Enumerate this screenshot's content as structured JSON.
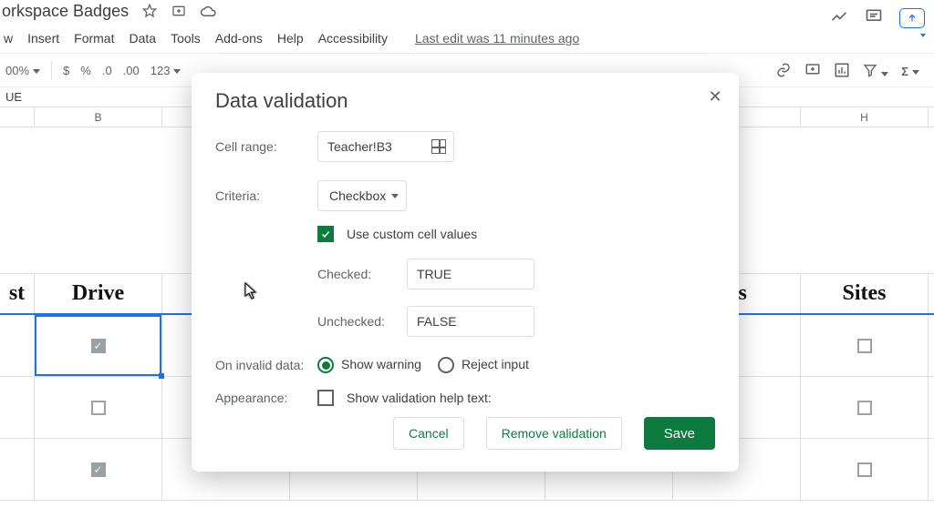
{
  "doc_title": "orkspace Badges",
  "menu": [
    "w",
    "Insert",
    "Format",
    "Data",
    "Tools",
    "Add-ons",
    "Help",
    "Accessibility"
  ],
  "last_edit": "Last edit was 11 minutes ago",
  "toolbar": {
    "zoom": "00%",
    "currency": "$",
    "percent": "%",
    "d1": ".0",
    "d2": ".00",
    "n123": "123"
  },
  "formula_bar": "UE",
  "col_headers": [
    "",
    "B",
    "",
    "",
    "",
    "",
    "",
    "H"
  ],
  "sheet_headers": {
    "a": "st",
    "b": "Drive",
    "g": "ns",
    "h": "Sites"
  },
  "rows_checked": {
    "b": [
      true,
      false,
      true
    ],
    "h": [
      false,
      false,
      false
    ]
  },
  "dialog": {
    "title": "Data validation",
    "labels": {
      "cell_range": "Cell range:",
      "criteria": "Criteria:",
      "use_custom": "Use custom cell values",
      "checked": "Checked:",
      "unchecked": "Unchecked:",
      "on_invalid": "On invalid data:",
      "show_warning": "Show warning",
      "reject_input": "Reject input",
      "appearance": "Appearance:",
      "show_help": "Show validation help text:"
    },
    "values": {
      "cell_range": "Teacher!B3",
      "criteria": "Checkbox",
      "checked": "TRUE",
      "unchecked": "FALSE"
    },
    "buttons": {
      "cancel": "Cancel",
      "remove": "Remove validation",
      "save": "Save"
    }
  }
}
